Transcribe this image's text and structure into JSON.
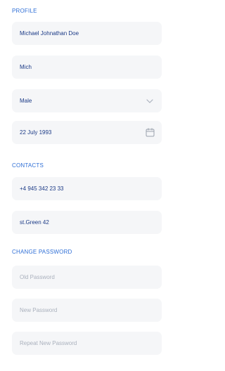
{
  "profile": {
    "section_title": "PROFILE",
    "full_name": "Michael Johnathan Doe",
    "nickname": "Mich",
    "gender": {
      "selected": "Male",
      "icon": "chevron-down-icon"
    },
    "birth_date": {
      "value": "22 July 1993",
      "icon": "calendar-icon"
    }
  },
  "contacts": {
    "section_title": "CONTACTS",
    "phone": "+4 945 342 23 33",
    "address": "st.Green 42"
  },
  "change_password": {
    "section_title": "CHANGE PASSWORD",
    "old_placeholder": "Old Password",
    "new_placeholder": "New Password",
    "repeat_placeholder": "Repeat New Password"
  },
  "colors": {
    "accent": "#2f6fd6",
    "value_text": "#1b3a86",
    "placeholder_text": "#aab1bd",
    "field_bg": "#f5f6f8"
  }
}
